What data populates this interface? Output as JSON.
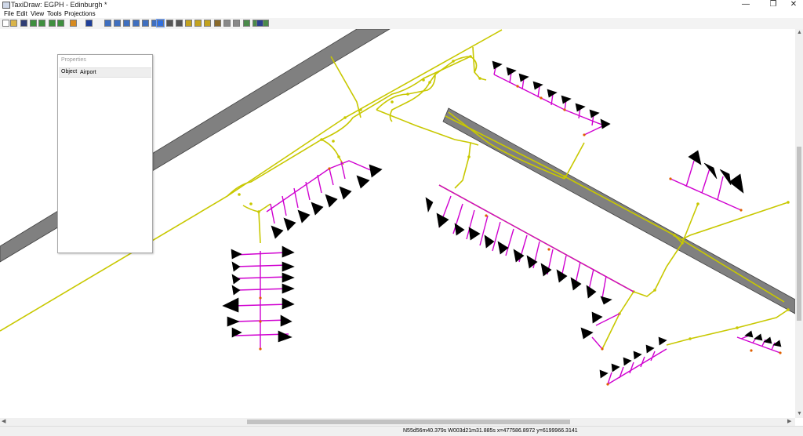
{
  "window": {
    "title": "TaxiDraw: EGPH - Edinburgh *",
    "minimize": "—",
    "maximize": "❐",
    "close": "✕"
  },
  "menu": {
    "items": [
      "File",
      "Edit",
      "View",
      "Tools",
      "Projections"
    ]
  },
  "toolbar": {
    "buttons": [
      {
        "icon": "new-file-icon",
        "color": "#ffffff"
      },
      {
        "icon": "open-folder-icon",
        "color": "#d9b44a"
      },
      {
        "icon": "save-icon",
        "color": "#2f3d74"
      },
      {
        "icon": "import-icon",
        "color": "#3f8f3f"
      },
      {
        "icon": "import-alt-icon",
        "color": "#3f8f3f"
      },
      {
        "icon": "export-icon",
        "color": "#3f8f3f"
      },
      {
        "icon": "export-alt-icon",
        "color": "#3f8f3f"
      },
      {
        "icon": "undo-icon",
        "color": "#d78a1e"
      },
      {
        "icon": "redo-icon",
        "color": "#1e3f9a"
      },
      {
        "icon": "zoom-in-icon",
        "color": "#3f6fbf"
      },
      {
        "icon": "zoom-out-icon",
        "color": "#3f6fbf"
      },
      {
        "icon": "zoom-fit-icon",
        "color": "#3f6fbf"
      },
      {
        "icon": "zoom-reset-icon",
        "color": "#3f6fbf"
      },
      {
        "icon": "zoom-area-icon",
        "color": "#3f6fbf"
      },
      {
        "icon": "zoom-all-icon",
        "color": "#3f6fbf"
      },
      {
        "icon": "select-pointer-icon",
        "color": "#2f6fdf"
      },
      {
        "icon": "runway-icon",
        "color": "#555555"
      },
      {
        "icon": "taxiway-icon",
        "color": "#555555"
      },
      {
        "icon": "parking-icon",
        "color": "#c2a21e"
      },
      {
        "icon": "node-icon",
        "color": "#c2a21e"
      },
      {
        "icon": "sign-icon",
        "color": "#c2a21e"
      },
      {
        "icon": "tower-icon",
        "color": "#8a6a2a"
      },
      {
        "icon": "windsock-icon",
        "color": "#888888"
      },
      {
        "icon": "walk-icon",
        "color": "#888888"
      },
      {
        "icon": "background-image-icon",
        "color": "#4a8a4a"
      },
      {
        "icon": "layer-icon",
        "color": "#4a8a4a"
      },
      {
        "icon": "layer-alt-icon",
        "color": "#4a8a4a"
      },
      {
        "icon": "gps-icon",
        "color": "#2b3f8f"
      }
    ]
  },
  "properties": {
    "title": "Properties",
    "key": "Object",
    "value": "Airport"
  },
  "status": {
    "text": "N55d56m40.379s W003d21m31.885s x=477586.8972 y=6199966.3141"
  },
  "map": {
    "colors": {
      "runway": "#808080",
      "taxiway": "#c8c800",
      "parking": "#d000d0",
      "node": "#e06000",
      "aircraft": "#000000"
    }
  }
}
